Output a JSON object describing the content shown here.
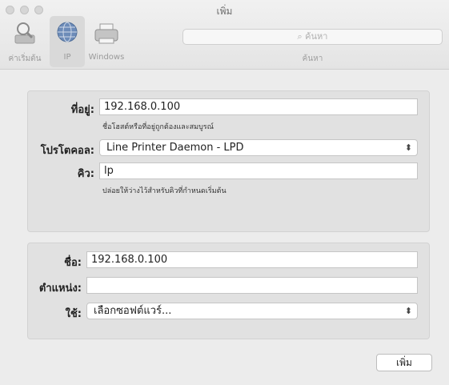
{
  "window": {
    "title": "เพิ่ม"
  },
  "toolbar": {
    "items": [
      {
        "label": "ค่าเริ่มต้น",
        "icon": "default-printer-icon"
      },
      {
        "label": "IP",
        "icon": "ip-globe-icon"
      },
      {
        "label": "Windows",
        "icon": "windows-printer-icon"
      }
    ],
    "search": {
      "placeholder": "ค้นหา",
      "label": "ค้นหา"
    }
  },
  "connection": {
    "address_label": "ที่อยู่:",
    "address_value": "192.168.0.100",
    "address_hint": "ชื่อโฮสต์หรือที่อยู่ถูกต้องและสมบูรณ์",
    "protocol_label": "โปรโตคอล:",
    "protocol_value": "Line Printer Daemon - LPD",
    "queue_label": "คิว:",
    "queue_value": "lp",
    "queue_hint": "ปล่อยให้ว่างไว้สำหรับคิวที่กำหนดเริ่มต้น"
  },
  "printer": {
    "name_label": "ชื่อ:",
    "name_value": "192.168.0.100",
    "location_label": "ตำแหน่ง:",
    "location_value": "",
    "use_label": "ใช้:",
    "use_value": "เลือกซอฟต์แวร์..."
  },
  "actions": {
    "add_label": "เพิ่ม"
  },
  "colors": {
    "background": "#ececec",
    "panel": "#e1e1e1",
    "field": "#ffffff"
  }
}
